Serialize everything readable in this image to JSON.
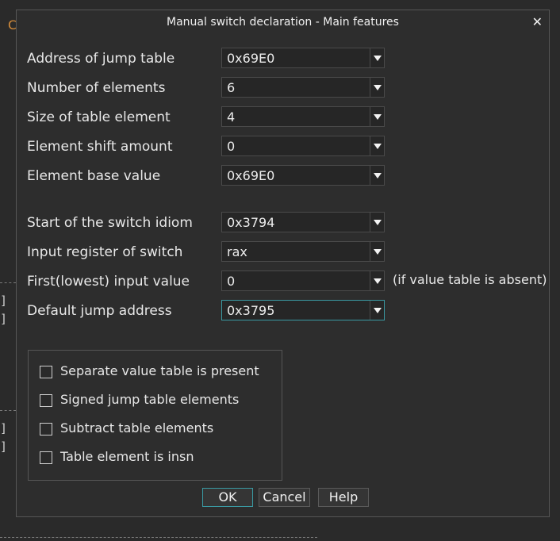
{
  "dialog": {
    "title": "Manual switch declaration - Main features",
    "close_glyph": "✕"
  },
  "fields": [
    {
      "label": "Address of jump table",
      "value": "0x69E0"
    },
    {
      "label": "Number of elements",
      "value": "6"
    },
    {
      "label": "Size of table element",
      "value": "4"
    },
    {
      "label": "Element shift amount",
      "value": "0"
    },
    {
      "label": "Element base value",
      "value": "0x69E0"
    },
    {
      "label": "Start of the switch idiom",
      "value": "0x3794"
    },
    {
      "label": "Input register of switch",
      "value": "rax"
    },
    {
      "label": "First(lowest) input value",
      "value": "0"
    },
    {
      "label": "Default jump address",
      "value": "0x3795"
    }
  ],
  "hint": "(if value table is absent)",
  "checkboxes": [
    {
      "label": "Separate value table is present",
      "checked": false
    },
    {
      "label": "Signed jump table elements",
      "checked": false
    },
    {
      "label": "Subtract table elements",
      "checked": false
    },
    {
      "label": "Table element is insn",
      "checked": false
    }
  ],
  "buttons": {
    "ok": "OK",
    "cancel": "Cancel",
    "help": "Help"
  },
  "background": {
    "corner_char": "C",
    "bracket": "]"
  },
  "colors": {
    "focus": "#3a9aa3",
    "background": "#2a2a2a"
  }
}
